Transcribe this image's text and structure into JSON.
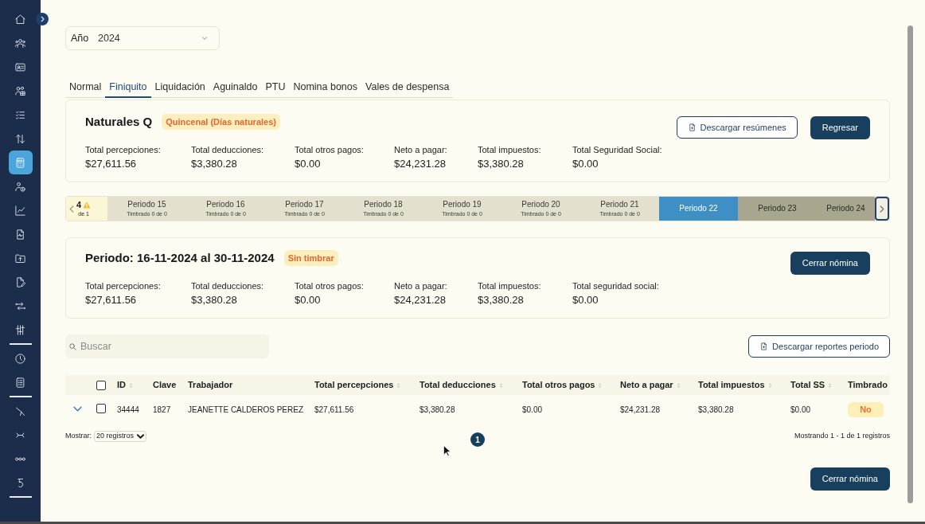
{
  "sidebar": {
    "groups": [
      {
        "items": [
          {
            "selected": false
          },
          {
            "selected": false
          },
          {
            "selected": false
          },
          {
            "selected": false
          },
          {
            "selected": false
          },
          {
            "selected": false
          },
          {
            "selected": true
          },
          {
            "selected": false
          },
          {
            "selected": false
          },
          {
            "selected": false
          },
          {
            "selected": false
          },
          {
            "selected": false
          },
          {
            "selected": false
          },
          {
            "selected": false
          }
        ]
      },
      {
        "items": [
          {
            "selected": false
          },
          {
            "selected": false
          }
        ]
      },
      {
        "items": [
          {
            "selected": false
          },
          {
            "selected": false
          },
          {
            "selected": false
          },
          {
            "selected": false
          }
        ]
      }
    ]
  },
  "year_filter": {
    "label": "Año",
    "value": "2024"
  },
  "tabs": [
    {
      "label": "Normal",
      "selected": false
    },
    {
      "label": "Finiquito",
      "selected": true
    },
    {
      "label": "Liquidación",
      "selected": false
    },
    {
      "label": "Aguinaldo",
      "selected": false
    },
    {
      "label": "PTU",
      "selected": false
    },
    {
      "label": "Nomina bonos",
      "selected": false
    },
    {
      "label": "Vales de despensa",
      "selected": false
    }
  ],
  "summary": {
    "title": "Naturales Q",
    "badge": "Quincenal (Días naturales)",
    "buttons": [
      {
        "label": "Descargar resúmenes",
        "kind": "outline"
      },
      {
        "label": "Regresar",
        "kind": "primary"
      }
    ],
    "stats": [
      {
        "label": "Total percepciones:",
        "value": "$27,611.56"
      },
      {
        "label": "Total deducciones:",
        "value": "$3,380.28"
      },
      {
        "label": "Total otros pagos:",
        "value": "$0.00"
      },
      {
        "label": "Neto a pagar:",
        "value": "$24,231.28"
      },
      {
        "label": "Total impuestos:",
        "value": "$3,380.28"
      },
      {
        "label": "Total Seguridad Social:",
        "value": "$0.00"
      }
    ]
  },
  "period_strip": {
    "count": "4",
    "warning": true,
    "caption": "de 1",
    "periods": [
      {
        "label": "Periodo 15",
        "subtitle": "Timbrado 0 de 0",
        "selected": false,
        "disabled": false
      },
      {
        "label": "Periodo 16",
        "subtitle": "Timbrado 0 de 0",
        "selected": false,
        "disabled": false
      },
      {
        "label": "Periodo 17",
        "subtitle": "Timbrado 0 de 0",
        "selected": false,
        "disabled": false
      },
      {
        "label": "Periodo 18",
        "subtitle": "Timbrado 0 de 0",
        "selected": false,
        "disabled": false
      },
      {
        "label": "Periodo 19",
        "subtitle": "Timbrado 0 de 0",
        "selected": false,
        "disabled": false
      },
      {
        "label": "Periodo 20",
        "subtitle": "Timbrado 0 de 0",
        "selected": false,
        "disabled": false
      },
      {
        "label": "Periodo 21",
        "subtitle": "Timbrado 0 de 0",
        "selected": false,
        "disabled": false
      },
      {
        "label": "Periodo 22",
        "selected": true,
        "disabled": false
      },
      {
        "label": "Periodo 23",
        "selected": false,
        "disabled": true
      },
      {
        "label": "Periodo 24",
        "selected": false,
        "disabled": true
      }
    ]
  },
  "period": {
    "title": "Periodo: 16-11-2024 al 30-11-2024",
    "badge": "Sin timbrar",
    "buttons": [
      {
        "label": "Cerrar nómina",
        "kind": "primary"
      }
    ],
    "stats": [
      {
        "label": "Total percepciones:",
        "value": "$27,611.56"
      },
      {
        "label": "Total deducciones:",
        "value": "$3,380.28"
      },
      {
        "label": "Total otros pagos:",
        "value": "$0.00"
      },
      {
        "label": "Neto a pagar:",
        "value": "$24,231.28"
      },
      {
        "label": "Total impuestos:",
        "value": "$3,380.28"
      },
      {
        "label": "Total seguridad social:",
        "value": "$0.00"
      }
    ]
  },
  "search": {
    "placeholder": "Buscar"
  },
  "toolbar_buttons": [
    {
      "label": "Descargar reportes periodo",
      "kind": "outline"
    }
  ],
  "table": {
    "select_all_checked": false,
    "columns": [
      {
        "label": "ID",
        "sortable": true
      },
      {
        "label": "Clave",
        "sortable": false
      },
      {
        "label": "Trabajador",
        "sortable": false
      },
      {
        "label": "Total percepciones",
        "sortable": true
      },
      {
        "label": "Total deducciones",
        "sortable": true
      },
      {
        "label": "Total otros pagos",
        "sortable": true
      },
      {
        "label": "Neto a pagar",
        "sortable": true
      },
      {
        "label": "Total impuestos",
        "sortable": true
      },
      {
        "label": "Total SS",
        "sortable": true
      },
      {
        "label": "Timbrado",
        "sortable": false
      }
    ],
    "rows": [
      {
        "expanded": false,
        "checked": false,
        "cells": [
          "34444",
          "1827",
          "JEANETTE CALDEROS PEREZ",
          "$27,611.56",
          "$3,380.28",
          "$0.00",
          "$24,231.28",
          "$3,380.28",
          "$0.00"
        ],
        "status": "No"
      }
    ]
  },
  "footer": {
    "page_size_label": "Mostrar:",
    "page_size": "20 registros",
    "pages": [
      {
        "label": "1",
        "selected": true
      }
    ],
    "summary": "Mostrando 1 - 1 de 1 registros"
  },
  "actions": [
    {
      "label": "Cerrar nómina",
      "kind": "primary"
    }
  ]
}
